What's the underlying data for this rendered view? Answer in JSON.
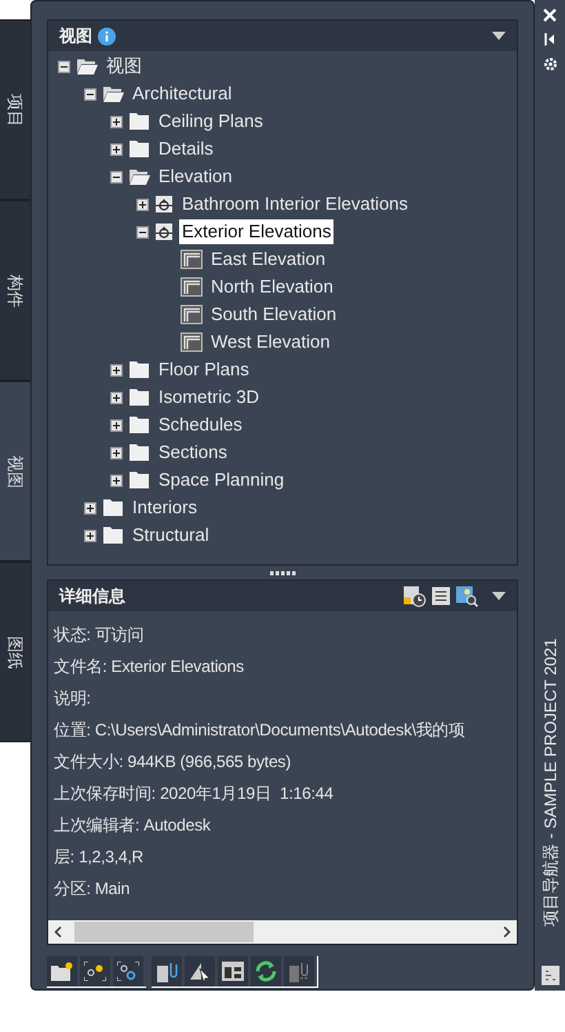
{
  "side_tabs": [
    {
      "label": "项目",
      "selected": false
    },
    {
      "label": "构件",
      "selected": false
    },
    {
      "label": "视图",
      "selected": true
    },
    {
      "label": "图纸",
      "selected": false
    }
  ],
  "views_panel": {
    "title": "视图",
    "tree": [
      {
        "label": "视图",
        "kind": "folder",
        "expanded": true,
        "selected": false,
        "children": [
          {
            "label": "Architectural",
            "kind": "folder",
            "expanded": true,
            "selected": false,
            "children": [
              {
                "label": "Ceiling Plans",
                "kind": "folder",
                "expanded": false,
                "selected": false
              },
              {
                "label": "Details",
                "kind": "folder",
                "expanded": false,
                "selected": false
              },
              {
                "label": "Elevation",
                "kind": "folder",
                "expanded": true,
                "selected": false,
                "children": [
                  {
                    "label": "Bathroom Interior Elevations",
                    "kind": "elevation",
                    "expanded": false,
                    "selected": false
                  },
                  {
                    "label": "Exterior Elevations",
                    "kind": "elevation",
                    "expanded": true,
                    "selected": true,
                    "children": [
                      {
                        "label": "East Elevation",
                        "kind": "view",
                        "selected": false
                      },
                      {
                        "label": "North Elevation",
                        "kind": "view",
                        "selected": false
                      },
                      {
                        "label": "South Elevation",
                        "kind": "view",
                        "selected": false
                      },
                      {
                        "label": "West Elevation",
                        "kind": "view",
                        "selected": false
                      }
                    ]
                  }
                ]
              },
              {
                "label": "Floor Plans",
                "kind": "folder",
                "expanded": false,
                "selected": false
              },
              {
                "label": "Isometric 3D",
                "kind": "folder",
                "expanded": false,
                "selected": false
              },
              {
                "label": "Schedules",
                "kind": "folder",
                "expanded": false,
                "selected": false
              },
              {
                "label": "Sections",
                "kind": "folder",
                "expanded": false,
                "selected": false
              },
              {
                "label": "Space Planning",
                "kind": "folder",
                "expanded": false,
                "selected": false
              }
            ]
          },
          {
            "label": "Interiors",
            "kind": "folder",
            "expanded": false,
            "selected": false
          },
          {
            "label": "Structural",
            "kind": "folder",
            "expanded": false,
            "selected": false
          }
        ]
      }
    ]
  },
  "details_panel": {
    "title": "详细信息",
    "lines": [
      "状态: 可访问",
      "文件名: Exterior Elevations",
      "说明:",
      "位置: C:\\Users\\Administrator\\Documents\\Autodesk\\我的项",
      "文件大小: 944KB (966,565 bytes)",
      "上次保存时间: 2020年1月19日  1:16:44",
      "上次编辑者: Autodesk",
      "层: 1,2,3,4,R",
      "分区: Main"
    ]
  },
  "palette_title": "项目导航器 - SAMPLE PROJECT 2021"
}
